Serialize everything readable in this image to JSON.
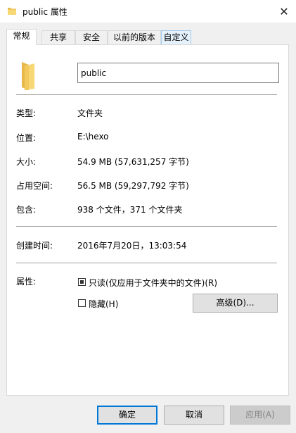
{
  "window": {
    "title": "public 属性",
    "close_glyph": "✕"
  },
  "tabs": [
    {
      "label": "常规",
      "active": true
    },
    {
      "label": "共享",
      "active": false
    },
    {
      "label": "安全",
      "active": false
    },
    {
      "label": "以前的版本",
      "active": false
    },
    {
      "label": "自定义",
      "active": false
    }
  ],
  "general": {
    "folder_name": "public",
    "rows": {
      "type": {
        "label": "类型:",
        "value": "文件夹"
      },
      "location": {
        "label": "位置:",
        "value": "E:\\hexo"
      },
      "size": {
        "label": "大小:",
        "value": "54.9 MB (57,631,257 字节)"
      },
      "size_on_disk": {
        "label": "占用空间:",
        "value": "56.5 MB (59,297,792 字节)"
      },
      "contains": {
        "label": "包含:",
        "value": "938 个文件，371 个文件夹"
      },
      "created": {
        "label": "创建时间:",
        "value": "2016年7月20日，13:03:54"
      }
    },
    "attributes": {
      "label": "属性:",
      "readonly_label": "只读(仅应用于文件夹中的文件)(R)",
      "readonly_state": "indeterminate",
      "hidden_label": "隐藏(H)",
      "hidden_state": "unchecked",
      "advanced_button": "高级(D)..."
    }
  },
  "footer": {
    "ok": "确定",
    "cancel": "取消",
    "apply": "应用(A)"
  },
  "colors": {
    "folder": "#f8d775",
    "folder_dark": "#e8b84a",
    "accent": "#0078d7"
  },
  "icons": {
    "title": "folder-icon",
    "big": "folder-icon",
    "close": "close-icon"
  }
}
